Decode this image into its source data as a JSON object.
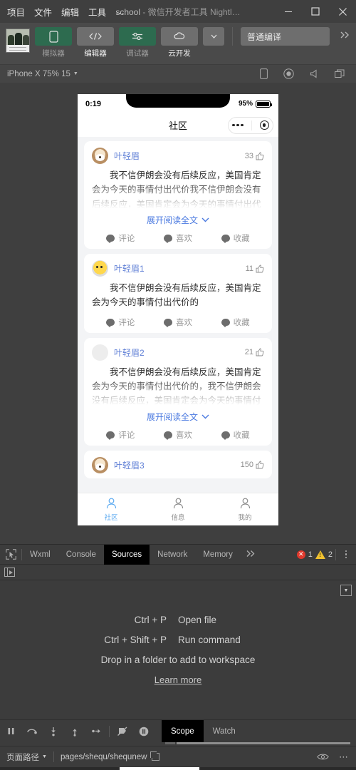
{
  "window": {
    "menus": [
      "项目",
      "文件",
      "编辑",
      "工具"
    ],
    "menu_more": "…",
    "title_project": "school",
    "title_sep": " - ",
    "title_app": "微信开发者工具 Nightl…",
    "minimize_icon": "minimize-icon",
    "maximize_icon": "maximize-icon",
    "close_icon": "close-icon"
  },
  "toolbar": {
    "project_thumb": "project-thumbnail",
    "buttons": [
      {
        "label": "模拟器",
        "icon": "phone-icon",
        "style": "green",
        "active": false
      },
      {
        "label": "编辑器",
        "icon": "code-icon",
        "style": "grey",
        "active": true
      },
      {
        "label": "调试器",
        "icon": "sliders-icon",
        "style": "green",
        "active": false
      },
      {
        "label": "云开发",
        "icon": "cloud-icon",
        "style": "grey",
        "active": true
      }
    ],
    "caret_icon": "chevron-down-icon",
    "compile_label": "普通编译",
    "overflow_icon": "double-chevron-right-icon"
  },
  "simbar": {
    "device": "iPhone X 75% 15",
    "caret_icon": "chevron-down-icon",
    "icons": [
      "phone-outline-icon",
      "record-icon",
      "volume-icon",
      "window-icon"
    ]
  },
  "phone": {
    "status": {
      "time": "0:19",
      "battery_pct": "95%",
      "battery_icon": "battery-icon"
    },
    "nav": {
      "title": "社区",
      "capsule_dots_icon": "more-dots-icon",
      "capsule_target_icon": "target-icon"
    },
    "posts": [
      {
        "avatar": "dog",
        "username": "叶轻眉",
        "likes": "33",
        "like_icon": "thumbs-up-icon",
        "text": "我不信伊朗会没有后续反应，美国肯定会为今天的事情付出代价我不信伊朗会没有后续反应，美国肯定会为今天的事情付出代价我不信伊朗会没有后续反应，美国肯定会为今天的事情付出代价",
        "clamped": true,
        "expand_label": "展开阅读全文",
        "expand_icon": "chevron-down-icon",
        "actions": [
          {
            "label": "评论",
            "icon": "comment-icon"
          },
          {
            "label": "喜欢",
            "icon": "like-icon"
          },
          {
            "label": "收藏",
            "icon": "star-icon"
          }
        ]
      },
      {
        "avatar": "emoji",
        "username": "叶轻眉1",
        "likes": "11",
        "like_icon": "thumbs-up-icon",
        "text": "我不信伊朗会没有后续反应，美国肯定会为今天的事情付出代价的",
        "clamped": false,
        "expand_label": "",
        "expand_icon": "",
        "actions": [
          {
            "label": "评论",
            "icon": "comment-icon"
          },
          {
            "label": "喜欢",
            "icon": "like-icon"
          },
          {
            "label": "收藏",
            "icon": "star-icon"
          }
        ]
      },
      {
        "avatar": "blank",
        "username": "叶轻眉2",
        "likes": "21",
        "like_icon": "thumbs-up-icon",
        "text": "我不信伊朗会没有后续反应，美国肯定会为今天的事情付出代价的，我不信伊朗会没有后续反应，美国肯定会为今天的事情付出代价的我不信伊朗会没有后续反应，美国肯定会为今天",
        "clamped": true,
        "expand_label": "展开阅读全文",
        "expand_icon": "chevron-down-icon",
        "actions": [
          {
            "label": "评论",
            "icon": "comment-icon"
          },
          {
            "label": "喜欢",
            "icon": "like-icon"
          },
          {
            "label": "收藏",
            "icon": "star-icon"
          }
        ]
      },
      {
        "avatar": "dog",
        "username": "叶轻眉3",
        "likes": "150",
        "like_icon": "thumbs-up-icon",
        "text": "",
        "clamped": false,
        "expand_label": "",
        "expand_icon": "",
        "actions": []
      }
    ],
    "tabs": [
      {
        "label": "社区",
        "icon": "person-icon",
        "active": true
      },
      {
        "label": "信息",
        "icon": "person-icon",
        "active": false
      },
      {
        "label": "我的",
        "icon": "person-icon",
        "active": false
      }
    ]
  },
  "devtools": {
    "inspect_icon": "inspect-cursor-icon",
    "tabs": [
      {
        "label": "Wxml",
        "active": false
      },
      {
        "label": "Console",
        "active": false
      },
      {
        "label": "Sources",
        "active": true
      },
      {
        "label": "Network",
        "active": false
      },
      {
        "label": "Memory",
        "active": false
      }
    ],
    "more_tabs_icon": "double-chevron-right-icon",
    "error_count": "1",
    "warning_count": "2",
    "error_icon": "error-icon",
    "warning_icon": "warning-icon",
    "kebab_icon": "kebab-menu-icon",
    "navigator_toggle_icon": "show-navigator-icon",
    "sources": {
      "shortcuts": [
        {
          "keys": "Ctrl + P",
          "action": "Open file"
        },
        {
          "keys": "Ctrl + Shift + P",
          "action": "Run command"
        }
      ],
      "drop_hint": "Drop in a folder to add to workspace",
      "learn_more": "Learn more",
      "collapse_icon": "collapse-panel-icon"
    },
    "debug_controls": [
      "pause-icon",
      "step-over-icon",
      "step-into-icon",
      "step-out-icon",
      "step-icon",
      "deactivate-breakpoints-icon",
      "pause-on-exceptions-icon"
    ],
    "scope_tabs": [
      {
        "label": "Scope",
        "active": true
      },
      {
        "label": "Watch",
        "active": false
      }
    ]
  },
  "statusbar": {
    "page_path_label": "页面路径",
    "caret_icon": "chevron-down-icon",
    "page_path": "pages/shequ/shequnew",
    "copy_icon": "copy-icon",
    "eye_icon": "eye-icon",
    "more_icon": "ellipsis-icon"
  }
}
